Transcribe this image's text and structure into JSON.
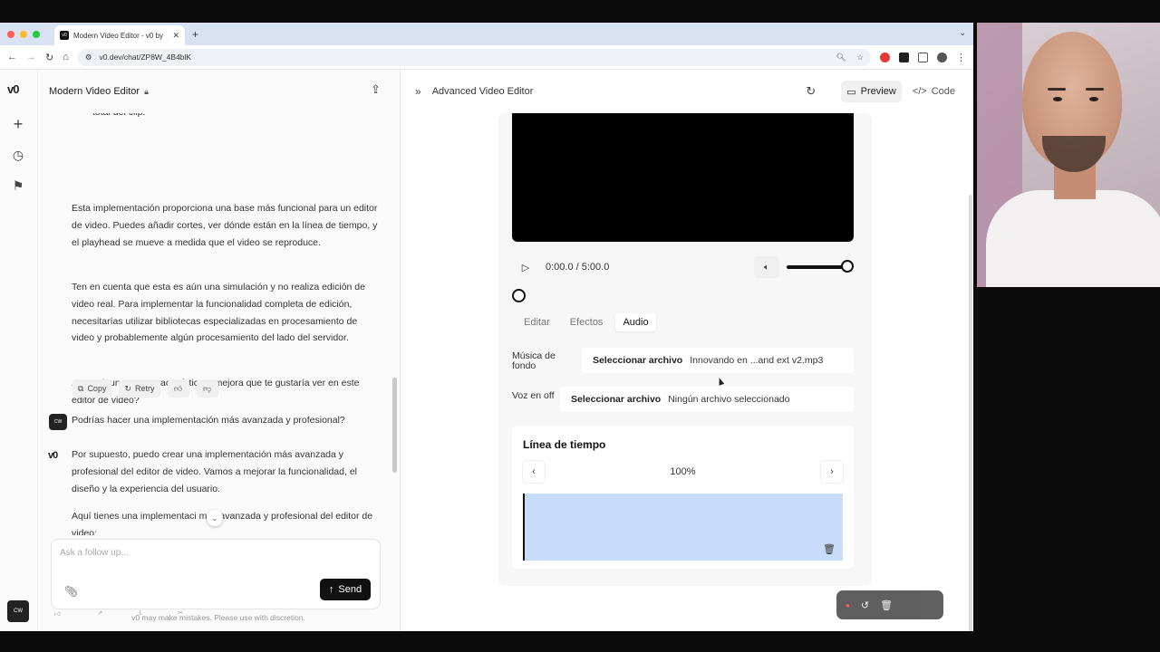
{
  "browser": {
    "tab_title": "Modern Video Editor - v0 by",
    "favicon": "v0",
    "url": "v0.dev/chat/ZP8W_4B4blK"
  },
  "app": {
    "logo": "v0",
    "user_avatar_text": "CW"
  },
  "chat": {
    "project_title": "Modern Video Editor",
    "top_fragment": "total del clip.",
    "p1": "Esta implementación proporciona una base más funcional para un editor de video. Puedes añadir cortes, ver dónde están en la línea de tiempo, y el playhead se mueve a medida que el video se reproduce.",
    "p2": "Ten en cuenta que esta es aún una simulación y no realiza edición de video real. Para implementar la funcionalidad completa de edición, necesitarías utilizar bibliotecas especializadas en procesamiento de video y probablemente algún procesamiento del lado del servidor.",
    "p3": "¿Hay alguna otra característica o mejora que te gustaría ver en este editor de video?",
    "actions": {
      "copy": "Copy",
      "retry": "Retry"
    },
    "user_message": "Podrías hacer una implementación más avanzada y profesional?",
    "reply_p1": "Por supuesto, puedo crear una implementación más avanzada y profesional del editor de video. Vamos a mejorar la funcionalidad, el diseño y la experiencia del usuario.",
    "reply_p2": "Aquí tienes una implementaci  más avanzada y profesional del editor de video:",
    "composer_placeholder": "Ask a follow up...",
    "send_label": "Send",
    "disclaimer": "v0 may make mistakes. Please use with discretion."
  },
  "preview": {
    "title": "Advanced Video Editor",
    "preview_label": "Preview",
    "code_label": "Code",
    "time": "0:00.0 / 5:00.0",
    "volume_level": 1.0,
    "tabs": [
      "Editar",
      "Efectos",
      "Audio"
    ],
    "active_tab": "Audio",
    "music_label": "Música de fondo",
    "music_button": "Seleccionar archivo",
    "music_file": "Innovando en ...and ext v2.mp3",
    "voice_label": "Voz en off",
    "voice_button": "Seleccionar archivo",
    "voice_file": "Ningún archivo seleccionado",
    "timeline_title": "Línea de tiempo",
    "zoom": "100%"
  },
  "colors": {
    "accent_dark": "#111111",
    "timeline_fill": "#c6dcf8",
    "tab_bar": "#d9e2f3"
  }
}
